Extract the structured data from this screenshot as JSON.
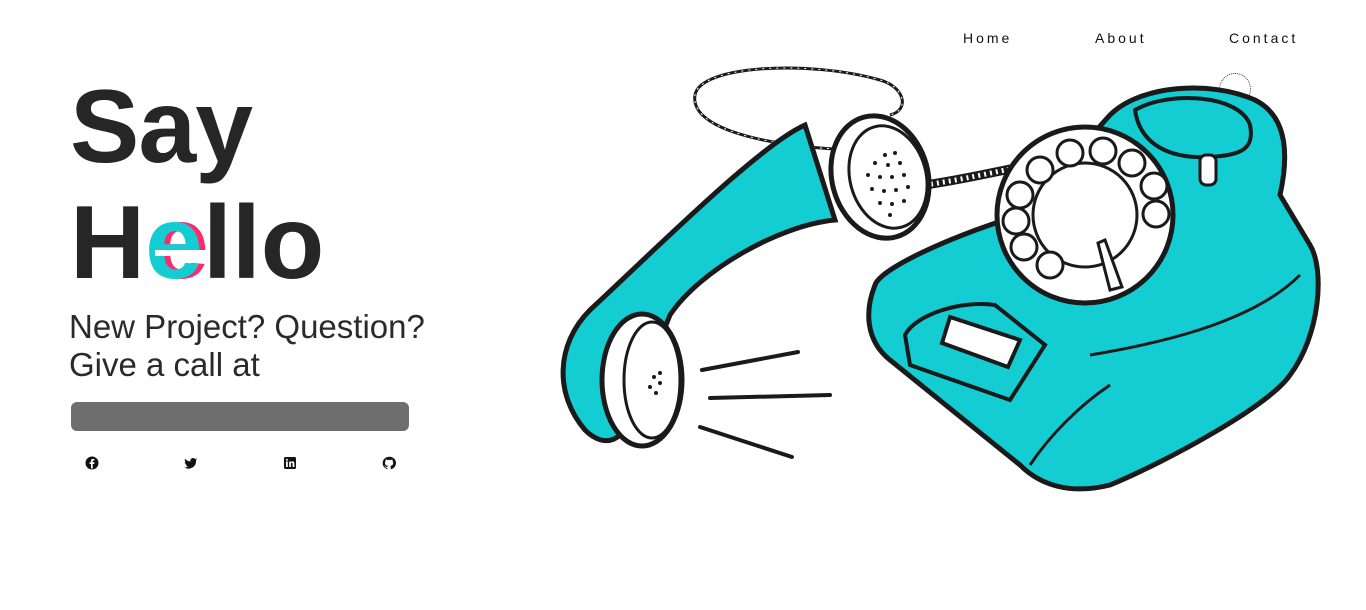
{
  "nav": {
    "home": "Home",
    "about": "About",
    "contact": "Contact"
  },
  "hero": {
    "line1": "Say",
    "hello_h": "H",
    "hello_e": "e",
    "hello_rest": "llo",
    "subtitle_line1": "New Project? Question?",
    "subtitle_line2": "Give a call at"
  },
  "socials": [
    "facebook-icon",
    "twitter-icon",
    "linkedin-icon",
    "github-icon"
  ],
  "colors": {
    "accent": "#13cdd3",
    "glitch": "#ff2a6d",
    "text": "#262626",
    "bar": "#6e6e6e"
  }
}
